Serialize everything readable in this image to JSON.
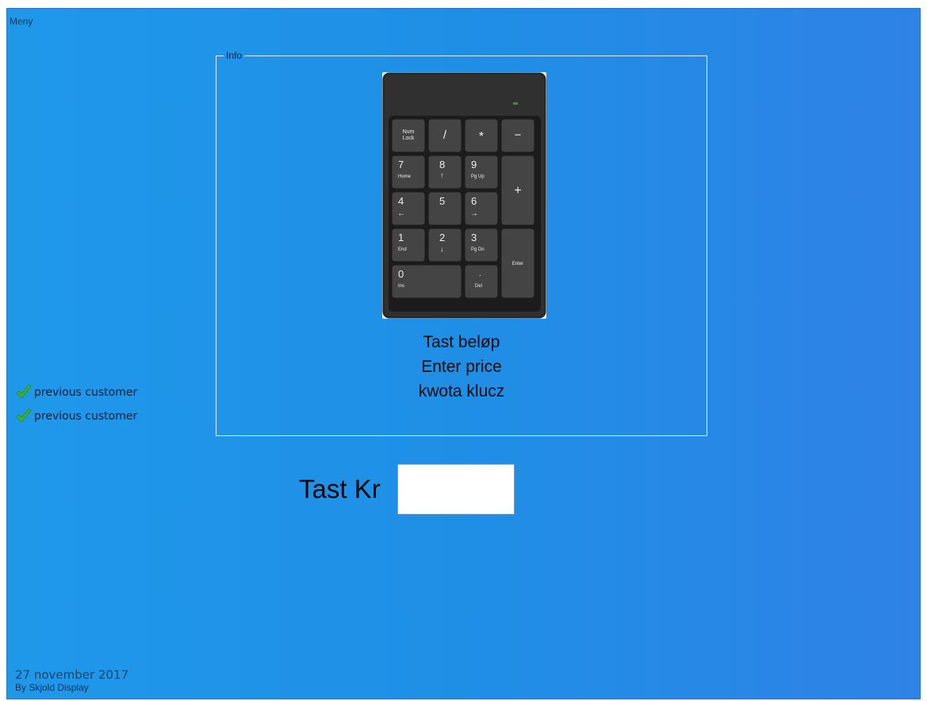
{
  "menu": {
    "label": "Meny"
  },
  "info": {
    "legend": "Info",
    "keypad_icon": "numeric-keypad-image",
    "keys": {
      "num_lock": [
        "Num",
        "Lock"
      ],
      "slash": "/",
      "star": "*",
      "minus": "−",
      "plus": "+",
      "enter": "Enter",
      "k7": [
        "7",
        "Home"
      ],
      "k8": [
        "8",
        "↑"
      ],
      "k9": [
        "9",
        "Pg Up"
      ],
      "k4": [
        "4",
        "←"
      ],
      "k5": "5",
      "k6": [
        "6",
        "→"
      ],
      "k1": [
        "1",
        "End"
      ],
      "k2": [
        "2",
        "↓"
      ],
      "k3": [
        "3",
        "Pg Dn"
      ],
      "k0": [
        "0",
        "Ins"
      ],
      "kdot": [
        ".",
        "Del"
      ]
    },
    "lines": [
      "Tast beløp",
      "Enter price",
      "kwota klucz"
    ]
  },
  "customers": [
    {
      "label": "previous customer",
      "icon": "check-icon"
    },
    {
      "label": "previous customer",
      "icon": "check-icon"
    }
  ],
  "amount": {
    "label": "Tast Kr",
    "value": ""
  },
  "footer": {
    "date": "27 november 2017",
    "by": "By Skjold Display"
  },
  "colors": {
    "background": "#1f98ea",
    "groupbox_border": "#d9ecfb",
    "check": "#3fb81f"
  }
}
